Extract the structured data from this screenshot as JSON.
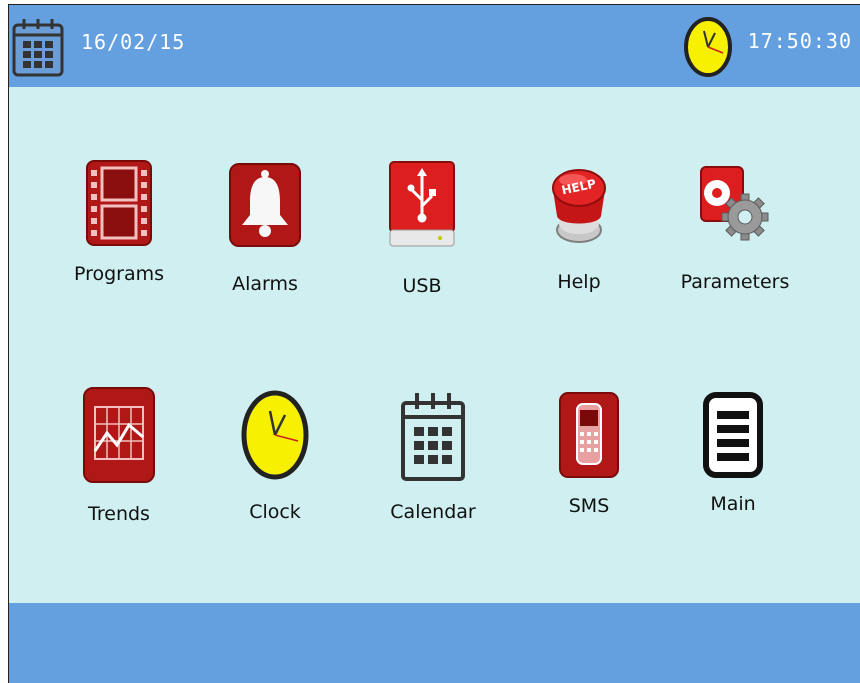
{
  "header": {
    "date": "16/02/15",
    "time": "17:50:30"
  },
  "menu": [
    {
      "label": "Programs",
      "icon": "film-icon"
    },
    {
      "label": "Alarms",
      "icon": "bell-icon"
    },
    {
      "label": "USB",
      "icon": "usb-drive-icon"
    },
    {
      "label": "Help",
      "icon": "help-button-icon"
    },
    {
      "label": "Parameters",
      "icon": "gear-drive-icon"
    },
    {
      "label": "Trends",
      "icon": "trend-chart-icon"
    },
    {
      "label": "Clock",
      "icon": "clock-icon"
    },
    {
      "label": "Calendar",
      "icon": "calendar-icon"
    },
    {
      "label": "SMS",
      "icon": "phone-icon"
    },
    {
      "label": "Main",
      "icon": "document-icon"
    }
  ],
  "colors": {
    "bar": "#64a0e0",
    "background": "#d0eff0",
    "icon_red": "#b01818",
    "clock_face": "#f7f000"
  }
}
